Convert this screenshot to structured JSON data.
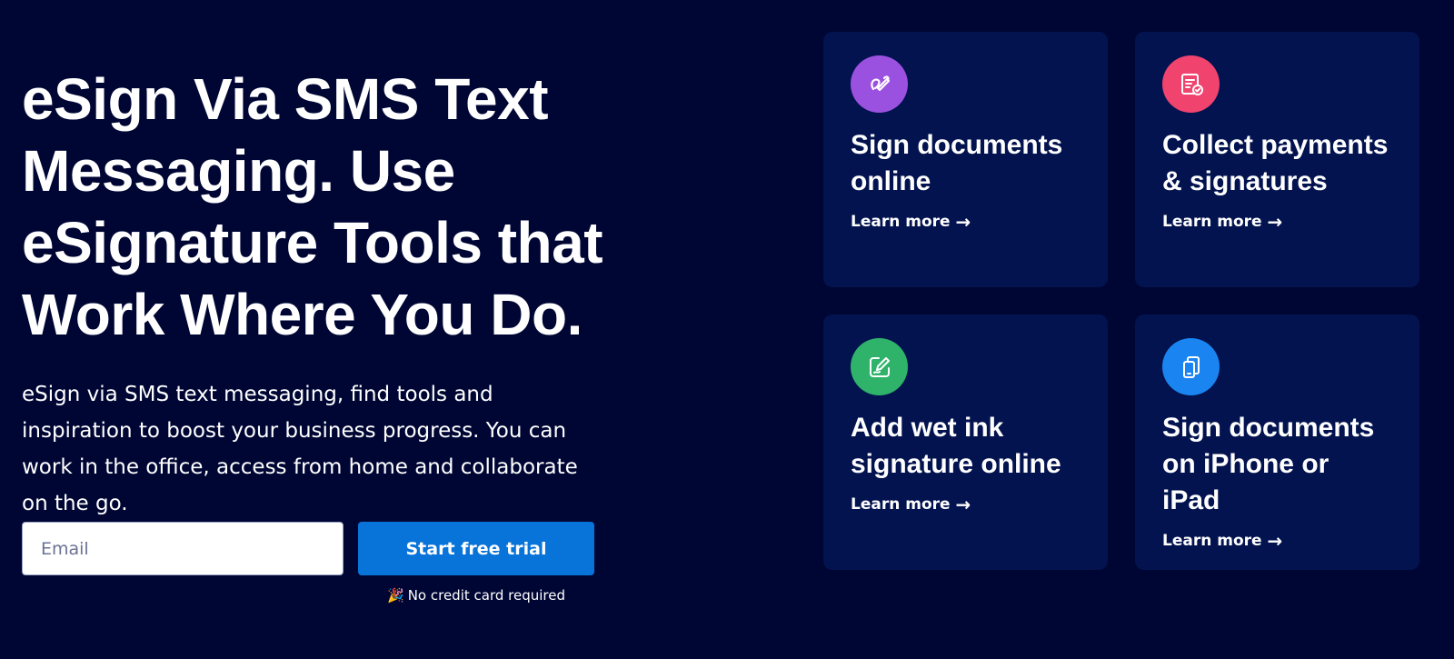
{
  "hero": {
    "headline": "eSign Via SMS Text Messaging. Use eSignature Tools that Work Where You Do.",
    "lead": "eSign via SMS text messaging, find tools and inspiration to boost your business progress. You can work in the office, access from home and collaborate on the go.",
    "email_placeholder": "Email",
    "email_value": "",
    "cta_label": "Start free trial",
    "no_credit_card": "No credit card required",
    "party_icon": "🎉"
  },
  "cards": [
    {
      "title": "Sign documents online",
      "link": "Learn more",
      "icon": "signature-pen-icon",
      "icon_color": "#9b51e0"
    },
    {
      "title": "Collect payments & signatures",
      "link": "Learn more",
      "icon": "invoice-check-icon",
      "icon_color": "#f0436e"
    },
    {
      "title": "Add wet ink signature online",
      "link": "Learn more",
      "icon": "edit-pen-icon",
      "icon_color": "#2fb36a"
    },
    {
      "title": "Sign documents on iPhone or iPad",
      "link": "Learn more",
      "icon": "mobile-devices-icon",
      "icon_color": "#1a85f0"
    }
  ],
  "colors": {
    "background": "#000634",
    "card_background": "#03134f",
    "cta_background": "#0873d9"
  }
}
